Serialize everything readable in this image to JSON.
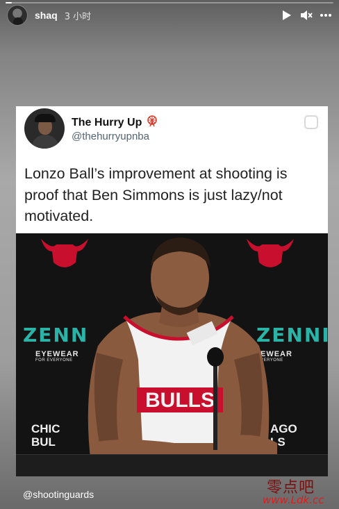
{
  "story": {
    "progress": 0.02,
    "username": "shaq",
    "time": "3 小时",
    "footer_handle": "@shootinguards",
    "icons": [
      "play-icon",
      "mute-icon",
      "more-icon"
    ]
  },
  "tweet": {
    "name": "The Hurry Up",
    "handle": "@thehurryupnba",
    "text": "Lonzo Ball’s improvement at shooting is proof that Ben Simmons is just lazy/not motivated.",
    "badge_icon": "ferris-wheel-icon"
  },
  "photo": {
    "backdrop_left": "ZENN",
    "backdrop_right": "ZENNI",
    "eyewear_left": "EYEWEAR",
    "eyewear_left_sub": "FOR EVERYONE",
    "eyewear_right": "EWEAR",
    "eyewear_right_sub": "VERYONE",
    "chic_left_1": "CHIC",
    "chic_left_2": "BUL",
    "chic_right_1": "AGO",
    "chic_right_2": "LS",
    "jersey": "BULLS"
  },
  "watermark": {
    "cn": "零点吧",
    "url": "www.Ldk.cc"
  },
  "colors": {
    "accent_red": "#ce1141",
    "teal": "#2bb3a8"
  }
}
